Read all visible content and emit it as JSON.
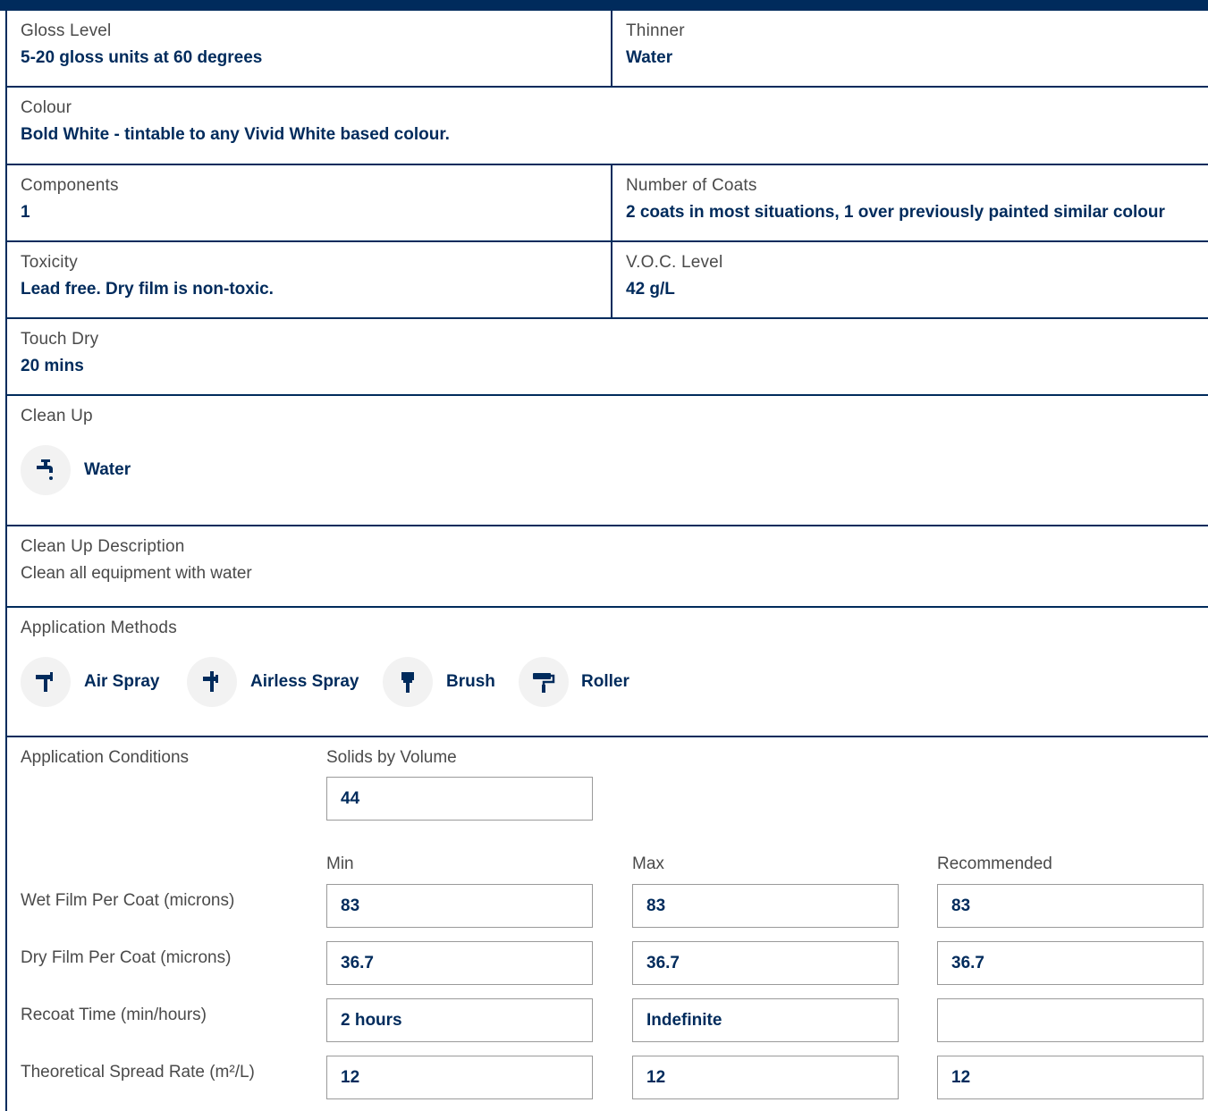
{
  "properties": {
    "gloss": {
      "label": "Gloss Level",
      "value": "5-20 gloss units at 60 degrees"
    },
    "thinner": {
      "label": "Thinner",
      "value": "Water"
    },
    "colour": {
      "label": "Colour",
      "value": "Bold White - tintable to any Vivid White based colour."
    },
    "components": {
      "label": "Components",
      "value": "1"
    },
    "coats": {
      "label": "Number of Coats",
      "value": "2 coats in most situations, 1 over previously painted similar colour"
    },
    "toxicity": {
      "label": "Toxicity",
      "value": "Lead free. Dry film is non-toxic."
    },
    "voc": {
      "label": "V.O.C. Level",
      "value": "42 g/L"
    },
    "touch_dry": {
      "label": "Touch Dry",
      "value": "20 mins"
    }
  },
  "clean_up": {
    "label": "Clean Up",
    "method": "Water",
    "icon": "tap-icon"
  },
  "clean_up_description": {
    "label": "Clean Up Description",
    "value": "Clean all equipment with water"
  },
  "application_methods": {
    "label": "Application Methods",
    "methods": [
      {
        "name": "Air Spray",
        "icon": "air-spray-icon"
      },
      {
        "name": "Airless Spray",
        "icon": "airless-spray-icon"
      },
      {
        "name": "Brush",
        "icon": "brush-icon"
      },
      {
        "name": "Roller",
        "icon": "roller-icon"
      }
    ]
  },
  "conditions": {
    "label": "Application Conditions",
    "solids_label": "Solids by Volume",
    "solids_value": "44",
    "columns": [
      "Min",
      "Max",
      "Recommended"
    ],
    "rows": [
      {
        "label": "Wet Film Per Coat (microns)",
        "values": [
          "83",
          "83",
          "83"
        ]
      },
      {
        "label": "Dry Film Per Coat (microns)",
        "values": [
          "36.7",
          "36.7",
          "36.7"
        ]
      },
      {
        "label": "Recoat Time (min/hours)",
        "values": [
          "2 hours",
          "Indefinite",
          ""
        ]
      },
      {
        "label": "Theoretical Spread Rate (m²/L)",
        "values": [
          "12",
          "12",
          "12"
        ]
      }
    ]
  },
  "colors": {
    "accent": "#002b5c",
    "text": "#4a4a4a",
    "icon_bg": "#f2f2f2"
  }
}
